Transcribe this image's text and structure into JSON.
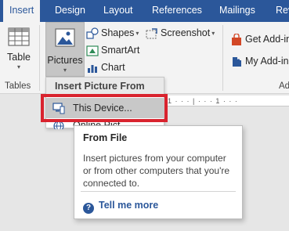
{
  "tabs": [
    {
      "label": "Insert",
      "active": true
    },
    {
      "label": "Design",
      "active": false
    },
    {
      "label": "Layout",
      "active": false
    },
    {
      "label": "References",
      "active": false
    },
    {
      "label": "Mailings",
      "active": false
    },
    {
      "label": "Rev",
      "active": false
    }
  ],
  "ribbon": {
    "tables": {
      "table_label": "Table",
      "group_label": "Tables"
    },
    "illustrations": {
      "pictures_label": "Pictures",
      "shapes_label": "Shapes",
      "smartart_label": "SmartArt",
      "chart_label": "Chart",
      "screenshot_label": "Screenshot"
    },
    "addins": {
      "get_addins_label": "Get Add-in",
      "my_addins_label": "My Add-in",
      "group_label_partial": "Ad"
    }
  },
  "ruler_text": "1 · · · | · · · 1 · · ·",
  "pictures_menu": {
    "header": "Insert Picture From",
    "items": [
      {
        "label": "This Device...",
        "highlighted": true
      },
      {
        "label": "Online Pict",
        "highlighted": false
      }
    ]
  },
  "tooltip": {
    "title": "From File",
    "body": "Insert pictures from your computer or from other computers that you're connected to.",
    "link": "Tell me more"
  },
  "colors": {
    "accent": "#2b579a",
    "highlight_box": "#d9232e",
    "ribbon_bg": "#f3f3f3",
    "pressed_bg": "#c5c5c5"
  }
}
